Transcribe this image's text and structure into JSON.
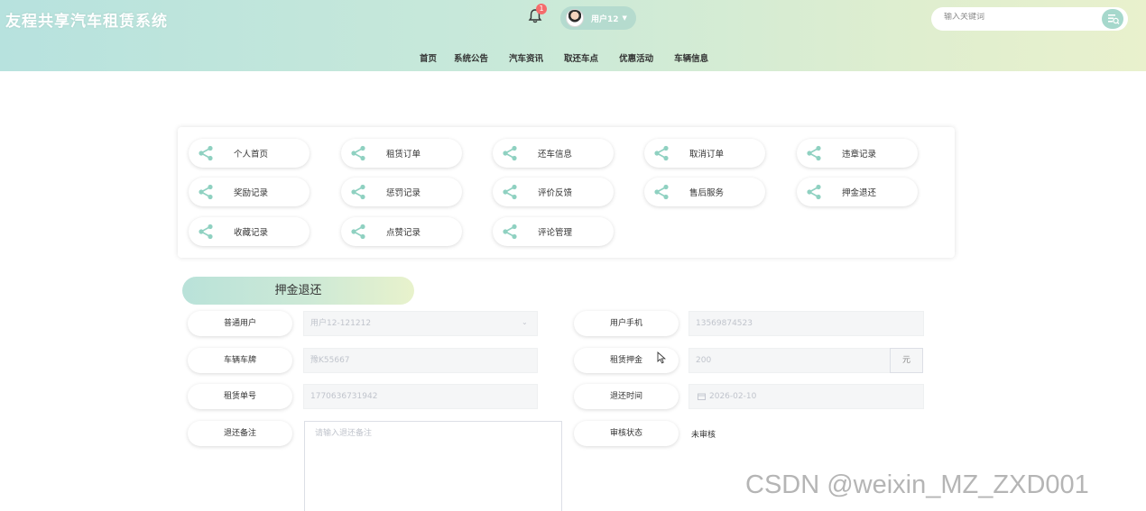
{
  "header": {
    "app_title": "友程共享汽车租赁系统",
    "notification_count": "1",
    "user_name": "用户12",
    "search_placeholder": "输入关键词"
  },
  "nav": {
    "items": [
      "首页",
      "系统公告",
      "汽车资讯",
      "取还车点",
      "优惠活动",
      "车辆信息"
    ]
  },
  "menu": {
    "items": [
      "个人首页",
      "租赁订单",
      "还车信息",
      "取消订单",
      "违章记录",
      "奖励记录",
      "惩罚记录",
      "评价反馈",
      "售后服务",
      "押金退还",
      "收藏记录",
      "点赞记录",
      "评论管理"
    ]
  },
  "section_title": "押金退还",
  "form": {
    "user_label": "普通用户",
    "user_value": "用户12-121212",
    "phone_label": "用户手机",
    "phone_value": "13569874523",
    "plate_label": "车辆车牌",
    "plate_value": "豫K55667",
    "deposit_label": "租赁押金",
    "deposit_value": "200",
    "deposit_unit": "元",
    "order_label": "租赁单号",
    "order_value": "1770636731942",
    "return_time_label": "退还时间",
    "return_time_value": "2026-02-10",
    "remark_label": "退还备注",
    "remark_placeholder": "请输入退还备注",
    "status_label": "审核状态",
    "status_value": "未审核"
  },
  "watermark": "CSDN @weixin_MZ_ZXD001",
  "colors": {
    "header_gradient_start": "#b7e2de",
    "header_gradient_end": "#e9f1cd",
    "accent_green": "#a6d8cc",
    "badge_red": "#f56c6c"
  },
  "icons": {
    "notification": "bell-icon",
    "search": "search-icon",
    "menu": "share-icon",
    "calendar": "calendar-icon"
  }
}
